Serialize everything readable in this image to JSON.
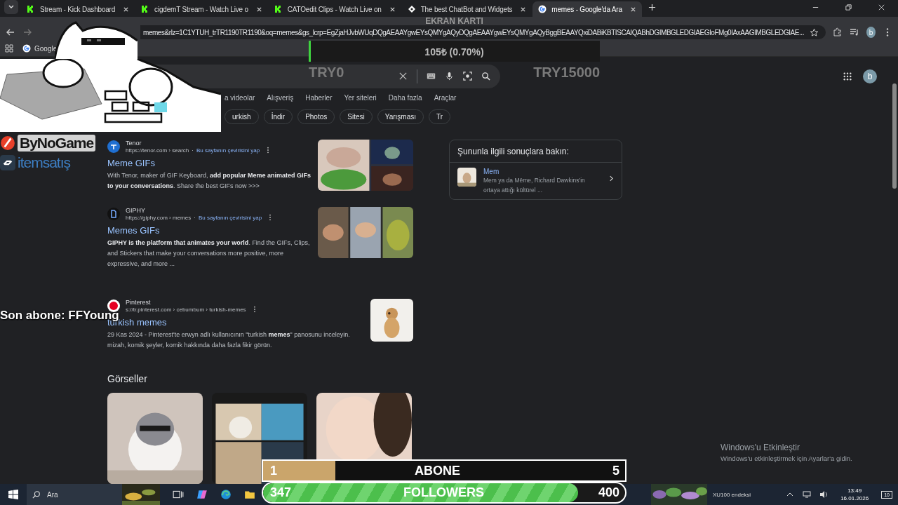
{
  "browser": {
    "tabs": [
      {
        "title": "Stream - Kick Dashboard",
        "selected": false
      },
      {
        "title": "cigdemT Stream - Watch Live o",
        "selected": false
      },
      {
        "title": "CATOedit Clips - Watch Live on",
        "selected": false
      },
      {
        "title": "The best ChatBot and Widgets",
        "selected": false
      },
      {
        "title": "memes - Google'da Ara",
        "selected": true
      }
    ],
    "address": "memes&rlz=1C1YTUH_trTR1190TR1190&oq=memes&gs_lcrp=EgZjaHJvbWUqDQgAEAAYgwEYsQMYgAQyDQgAEAAYgwEYsQMYgAQyBggBEAAYQxiDABiKBTISCAIQABhDGIMBGLEDGIAEGIoFMg0IAxAAGIMBGLEDGIAE...",
    "profile": "b",
    "bookmarks": [
      {
        "label": "Google"
      }
    ]
  },
  "google": {
    "avatar": "b",
    "nav": [
      "a videolar",
      "Alışveriş",
      "Haberler",
      "Yer siteleri",
      "Daha fazla",
      "Araçlar"
    ],
    "chips": [
      "urkish",
      "İndir",
      "Photos",
      "Sitesi",
      "Yarışması",
      "Tr"
    ],
    "results": [
      {
        "source": "Tenor",
        "url": "https://tenor.com › search",
        "dot": "·",
        "translate": "Bu sayfanın çevirisini yap",
        "title": "Meme GIFs",
        "snippet": "With Tenor, maker of GIF Keyboard, **add popular Meme animated GIFs to your conversations**. Share the best GIFs now >>>"
      },
      {
        "source": "GIPHY",
        "url": "https://giphy.com › memes",
        "dot": "·",
        "translate": "Bu sayfanın çevirisini yap",
        "title": "Memes GIFs",
        "snippet": "**GIPHY is the platform that animates your world**. Find the GIFs, Clips, and Stickers that make your conversations more positive, more expressive, and more ..."
      },
      {
        "source": "Pinterest",
        "url": "s://tr.pinterest.com › cebumbum › turkish-memes",
        "title": "turkish memes",
        "snippet": "29 Kas 2024 - Pinterest'te erwyn adlı kullanıcının \"turkish **memes**\" panosunu inceleyin. mizah, komik şeyler, komik hakkında daha fazla fikir görün."
      }
    ],
    "images_heading": "Görseller",
    "related": {
      "title": "Şununla ilgili sonuçlara bakın:",
      "items": [
        {
          "name": "Mem",
          "description": "Mem ya da Mēme, Richard Dawkins'in ortaya attığı kültürel ..."
        }
      ]
    }
  },
  "overlay": {
    "sponsors": [
      "ByNoGame",
      "itemsatış"
    ],
    "last_sub": "Son abone: FFYoung",
    "gpu_goal": {
      "label": "EKRAN KARTI",
      "value": "105₺ (0.70%)",
      "min": "TRY0",
      "max": "TRY15000",
      "level": 0.007
    },
    "goals": [
      {
        "kind": "plain",
        "current": "1",
        "label": "ABONE",
        "target": "5",
        "level": 0.2
      },
      {
        "kind": "striped",
        "current": "347",
        "label": "FOLLOWERS",
        "target": "400",
        "level": 0.87
      }
    ]
  },
  "activation": {
    "title": "Windows'u Etkinleştir",
    "text": "Windows'u etkinleştirmek için Ayarlar'a gidin."
  },
  "taskbar": {
    "search": "Ara",
    "widget": "XU100 endeksi",
    "time": "13:49",
    "date": "16.01.2026",
    "notifications": "10"
  }
}
